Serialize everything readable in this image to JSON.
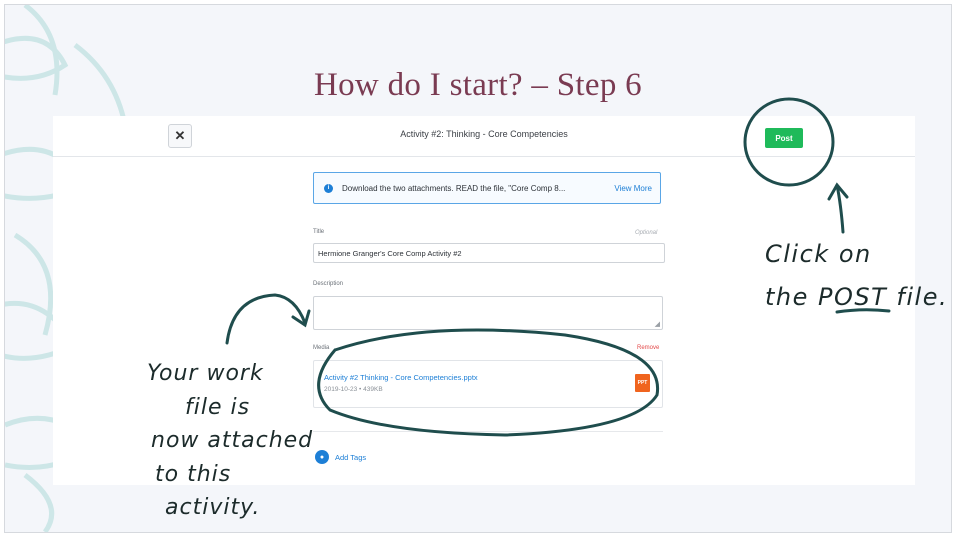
{
  "slide": {
    "title": "How do I start? – Step 6"
  },
  "header": {
    "close_glyph": "✕",
    "title": "Activity #2: Thinking - Core Competencies",
    "post_label": "Post"
  },
  "banner": {
    "icon_glyph": "i",
    "text": "Download the two attachments. READ the file, \"Core Comp 8...",
    "view_more": "View More"
  },
  "form": {
    "title_label": "Title",
    "title_optional": "Optional",
    "title_value": "Hermione Granger's Core Comp Activity #2",
    "description_label": "Description",
    "media_label": "Media",
    "remove_label": "Remove",
    "media": {
      "filename": "Activity #2 Thinking - Core Competencies.pptx",
      "meta": "2019-10-23 • 439KB",
      "icon_text": "PPT"
    },
    "add_tags": "Add Tags"
  },
  "annotations": {
    "left_lines": [
      "Your work",
      "file is",
      "now attached",
      "to this",
      "activity."
    ],
    "right_lines": [
      "Click on",
      "the POST file."
    ]
  },
  "colors": {
    "title": "#7a3b52",
    "post_button": "#1fba5a",
    "link": "#1d7fd6",
    "remove": "#e34a4a",
    "ink": "#1c2b2b",
    "circle_ink": "#1f4d4d"
  }
}
